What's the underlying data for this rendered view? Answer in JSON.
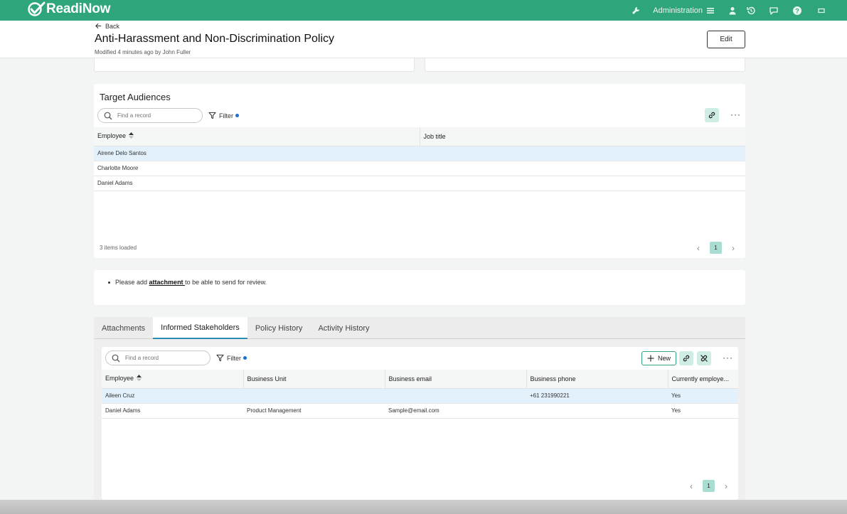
{
  "app": {
    "name": "ReadiNow",
    "admin_label": "Administration"
  },
  "header": {
    "back_label": "Back",
    "title": "Anti-Harassment and Non-Discrimination Policy",
    "modified": "Modified 4 minutes ago by John Fuller",
    "edit_label": "Edit"
  },
  "target_audiences": {
    "title": "Target Audiences",
    "search_placeholder": "Find a record",
    "filter_label": "Filter",
    "columns": [
      "Employee",
      "Job title"
    ],
    "rows": [
      {
        "employee": "Airene Delo Santos",
        "job_title": ""
      },
      {
        "employee": "Charlotte Moore",
        "job_title": ""
      },
      {
        "employee": "Daniel Adams",
        "job_title": ""
      }
    ],
    "items_loaded": "3 items loaded",
    "page": "1"
  },
  "notice": {
    "pre": "Please add ",
    "link": "attachment ",
    "post": "to be able to send for review."
  },
  "tabs": [
    {
      "label": "Attachments",
      "active": false
    },
    {
      "label": "Informed Stakeholders",
      "active": true
    },
    {
      "label": "Policy History",
      "active": false
    },
    {
      "label": "Activity History",
      "active": false
    }
  ],
  "stakeholders": {
    "search_placeholder": "Find a record",
    "filter_label": "Filter",
    "new_label": "New",
    "columns": [
      "Employee",
      "Business Unit",
      "Business email",
      "Business phone",
      "Currently employe..."
    ],
    "rows": [
      {
        "employee": "Aileen Cruz",
        "unit": "",
        "email": "",
        "phone": "+61 231990221",
        "employed": "Yes"
      },
      {
        "employee": "Daniel Adams",
        "unit": "Product Management",
        "email": "Sample@email.com",
        "phone": "",
        "employed": "Yes"
      }
    ],
    "page": "1"
  },
  "colors": {
    "brand": "#2fa57c",
    "selected_row": "#e2f1fb",
    "active_tab": "#2a8bb5"
  }
}
